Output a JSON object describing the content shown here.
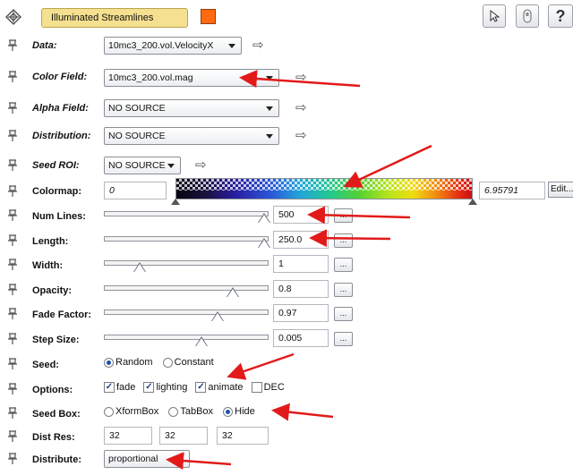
{
  "header": {
    "title": "Illuminated Streamlines",
    "swatch_color": "#ff6a10",
    "icons": [
      "module-icon",
      "pointer-icon",
      "lock-icon",
      "help-icon"
    ],
    "help_label": "?"
  },
  "rows": {
    "data": {
      "label": "Data:",
      "value": "10mc3_200.vol.VelocityX"
    },
    "color_field": {
      "label": "Color Field:",
      "value": "10mc3_200.vol.mag"
    },
    "alpha_field": {
      "label": "Alpha Field:",
      "value": "NO SOURCE"
    },
    "distribution": {
      "label": "Distribution:",
      "value": "NO SOURCE"
    },
    "seed_roi": {
      "label": "Seed ROI:",
      "value": "NO SOURCE"
    },
    "colormap": {
      "label": "Colormap:",
      "min": "0",
      "max": "6.95791",
      "edit_label": "Edit..."
    },
    "num_lines": {
      "label": "Num Lines:",
      "value": "500",
      "level": 1.0
    },
    "length": {
      "label": "Length:",
      "value": "250.0",
      "level": 1.0
    },
    "width": {
      "label": "Width:",
      "value": "1",
      "level": 0.2
    },
    "opacity": {
      "label": "Opacity:",
      "value": "0.8",
      "level": 0.8
    },
    "fade_factor": {
      "label": "Fade Factor:",
      "value": "0.97",
      "level": 0.7
    },
    "step_size": {
      "label": "Step Size:",
      "value": "0.005",
      "level": 0.6
    },
    "seed": {
      "label": "Seed:",
      "options": [
        "Random",
        "Constant"
      ],
      "selected": "Random"
    },
    "options": {
      "label": "Options:",
      "items": [
        {
          "label": "fade",
          "checked": true
        },
        {
          "label": "lighting",
          "checked": true
        },
        {
          "label": "animate",
          "checked": true
        },
        {
          "label": "DEC",
          "checked": false
        }
      ]
    },
    "seed_box": {
      "label": "Seed Box:",
      "options": [
        "XformBox",
        "TabBox",
        "Hide"
      ],
      "selected": "Hide"
    },
    "dist_res": {
      "label": "Dist Res:",
      "values": [
        "32",
        "32",
        "32"
      ]
    },
    "distribute": {
      "label": "Distribute:",
      "value": "proportional"
    }
  },
  "ellipsis_label": "...",
  "check_mark": "✓",
  "annotation_color": "#e21a1a"
}
